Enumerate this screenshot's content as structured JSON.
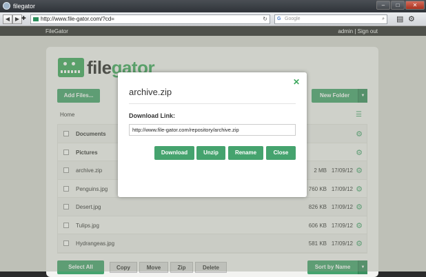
{
  "browser": {
    "title": "filegator",
    "url": "http://www.file-gator.com/?cd=",
    "search_placeholder": "Google"
  },
  "topnav": {
    "brand": "FileGator",
    "user": "admin | Sign out"
  },
  "logo": {
    "text_prefix": "file",
    "text_suffix": "gator"
  },
  "toolbar": {
    "add_files": "Add Files...",
    "new_folder": "New Folder"
  },
  "breadcrumb": "Home",
  "files": [
    {
      "name": "Documents",
      "type": "dir",
      "size": "",
      "date": ""
    },
    {
      "name": "Pictures",
      "type": "dir",
      "size": "",
      "date": ""
    },
    {
      "name": "archive.zip",
      "type": "file",
      "size": "2 MB",
      "date": "17/09/12"
    },
    {
      "name": "Penguins.jpg",
      "type": "file",
      "size": "760 KB",
      "date": "17/09/12"
    },
    {
      "name": "Desert.jpg",
      "type": "file",
      "size": "826 KB",
      "date": "17/09/12"
    },
    {
      "name": "Tulips.jpg",
      "type": "file",
      "size": "606 KB",
      "date": "17/09/12"
    },
    {
      "name": "Hydrangeas.jpg",
      "type": "file",
      "size": "581 KB",
      "date": "17/09/12"
    }
  ],
  "bottom": {
    "select_all": "Select All",
    "copy": "Copy",
    "move": "Move",
    "zip": "Zip",
    "delete": "Delete",
    "sort": "Sort by Name"
  },
  "modal": {
    "title": "archive.zip",
    "label": "Download Link:",
    "link": "http://www.file-gator.com/repository/archive.zip",
    "download": "Download",
    "unzip": "Unzip",
    "rename": "Rename",
    "close": "Close"
  },
  "colors": {
    "accent": "#45a36e",
    "brand": "#3fa85f"
  }
}
